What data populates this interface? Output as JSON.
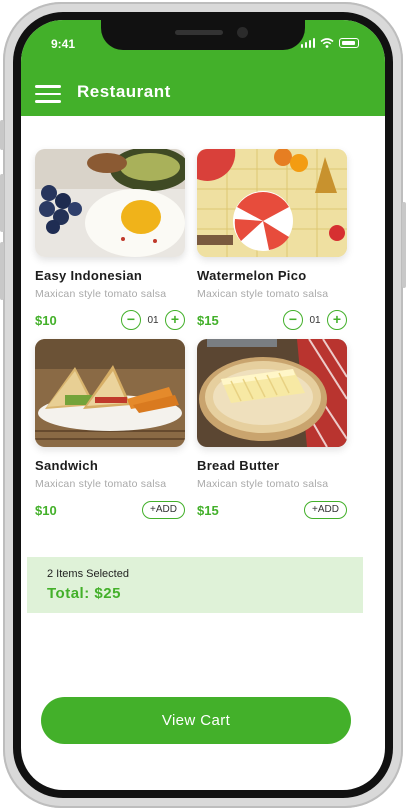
{
  "status_bar": {
    "time": "9:41"
  },
  "header": {
    "title": "Restaurant",
    "menu_icon": "hamburger-menu-icon"
  },
  "items": [
    {
      "name": "Easy Indonesian",
      "description": "Maxican style tomato salsa",
      "price": "$10",
      "quantity": "01",
      "control": "stepper"
    },
    {
      "name": "Watermelon Pico",
      "description": "Maxican style tomato salsa",
      "price": "$15",
      "quantity": "01",
      "control": "stepper"
    },
    {
      "name": "Sandwich",
      "description": "Maxican style tomato salsa",
      "price": "$10",
      "add_label": "+ADD",
      "control": "add"
    },
    {
      "name": "Bread Butter",
      "description": "Maxican style tomato salsa",
      "price": "$15",
      "add_label": "+ADD",
      "control": "add"
    }
  ],
  "summary": {
    "items_selected": "2 Items Selected",
    "total": "Total: $25"
  },
  "cart_button": {
    "label": "View Cart"
  },
  "colors": {
    "accent": "#43b02a",
    "summary_bg": "#dff2d8",
    "price": "#43b02a"
  }
}
